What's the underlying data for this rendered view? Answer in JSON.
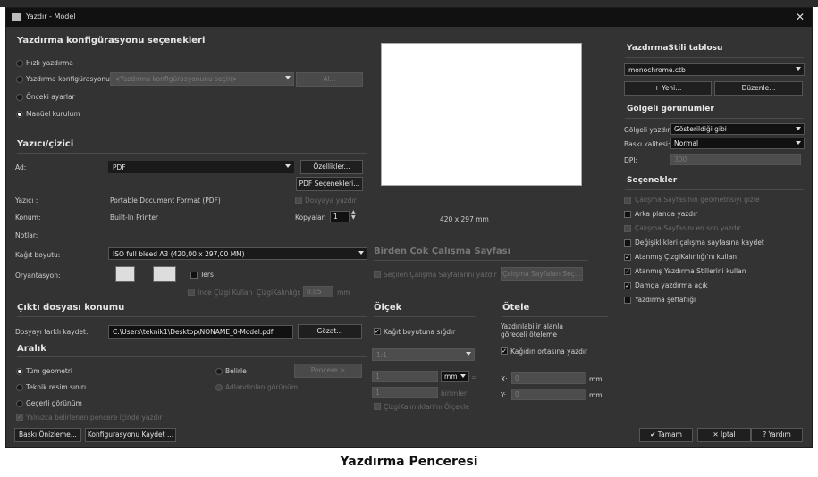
{
  "window": {
    "title": "Yazdır - Model"
  },
  "config": {
    "heading": "Yazdırma konfigürasyonu seçenekleri",
    "quick": "Hızlı yazdırma",
    "printer_config": "Yazdırma konfigürasyonu:",
    "printer_config_placeholder": "<Yazdırma konfigürasyonunu seçin>",
    "add": "Al...",
    "previous": "Önceki ayarlar",
    "manual": "Manüel kurulum"
  },
  "printer": {
    "heading": "Yazıcı/çizici",
    "name_label": "Ad:",
    "name_value": "PDF",
    "properties": "Özellikler...",
    "pdf_options": "PDF Seçenekleri...",
    "printer_label": "Yazıcı :",
    "printer_value": "Portable Document Format (PDF)",
    "print_to_file": "Dosyaya yazdır",
    "location_label": "Konum:",
    "location_value": "Built-In Printer",
    "copies_label": "Kopyalar:",
    "copies_value": "1",
    "notes_label": "Notlar:",
    "paper_label": "Kağıt boyutu:",
    "paper_value": "ISO full bleed A3 (420,00 x 297,00 MM)",
    "orientation_label": "Oryantasyon:",
    "reverse": "Ters",
    "thin_lines": "İnce Çizgi Kullan",
    "lineweight_label": "ÇizgiKalınlığı:",
    "lineweight_value": "0.05",
    "lineweight_unit": "mm"
  },
  "output": {
    "heading": "Çıktı dosyası konumu",
    "saveas_label": "Dosyayı farklı kaydet:",
    "path": "C:\\Users\\teknik1\\Desktop\\NONAME_0-Model.pdf",
    "browse": "Gözat..."
  },
  "range": {
    "heading": "Aralık",
    "all_geometry": "Tüm geometri",
    "technical": "Teknik resim sınırı",
    "current": "Geçerli görünüm",
    "selected": "Belirle",
    "window_btn": "Pencere >",
    "named_view": "Adlandırılan görünüm",
    "only_in_window": "Yalnızca belirlenen pencere içinde yazdır"
  },
  "preview": {
    "size": "420 x 297 mm"
  },
  "multi": {
    "heading": "Birden Çok Çalışma Sayfası",
    "print_selected": "Seçilen Çalışma Sayfalarını yazdır",
    "select_sheets": "Çalışma Sayfaları Seç..."
  },
  "scale": {
    "heading": "Ölçek",
    "fit": "Kağıt boyutuna sığdır",
    "ratio": "1:1",
    "val1": "1",
    "unit1": "mm",
    "eq": "=",
    "val2": "1",
    "unit2": "birimler",
    "scale_lw": "ÇizgiKalınlıkları'nı Ölçekle"
  },
  "offset": {
    "heading": "Ötele",
    "relative": "Yazdırılabilir alanla göreceli öteleme",
    "center": "Kağıdın ortasına yazdır",
    "x_label": "X:",
    "x_value": "0",
    "y_label": "Y:",
    "y_value": "0",
    "unit": "mm"
  },
  "style": {
    "heading": "YazdırmaStili tablosu",
    "value": "monochrome.ctb",
    "new": "+ Yeni...",
    "edit": "Düzenle..."
  },
  "shaded": {
    "heading": "Gölgeli görünümler",
    "shade_label": "Gölgeli yazdır:",
    "shade_value": "Gösterildiği gibi",
    "quality_label": "Baskı kalitesi:",
    "quality_value": "Normal",
    "dpi_label": "DPI:",
    "dpi_value": "300"
  },
  "options": {
    "heading": "Seçenekler",
    "items": [
      {
        "label": "Çalışma Sayfasının geometrisiyi gizle",
        "state": "disabled"
      },
      {
        "label": "Arka planda yazdır",
        "state": "off"
      },
      {
        "label": "Çalışma Sayfasını en son yazdır",
        "state": "disabled"
      },
      {
        "label": "Değişiklikleri çalışma sayfasına kaydet",
        "state": "off"
      },
      {
        "label": "Atanmış ÇizgiKalınlığı'nı kullan",
        "state": "on"
      },
      {
        "label": "Atanmış Yazdırma Stillerini kullan",
        "state": "on"
      },
      {
        "label": "Damga yazdırma açık",
        "state": "on"
      },
      {
        "label": "Yazdırma şeffaflığı",
        "state": "off"
      }
    ]
  },
  "footer": {
    "preview": "Baskı Önizleme...",
    "save_config": "Konfigurasyonu Kaydet ...",
    "ok": "✔ Tamam",
    "cancel": "✕ İptal",
    "help": "? Yardım"
  },
  "caption": "Yazdırma Penceresi"
}
